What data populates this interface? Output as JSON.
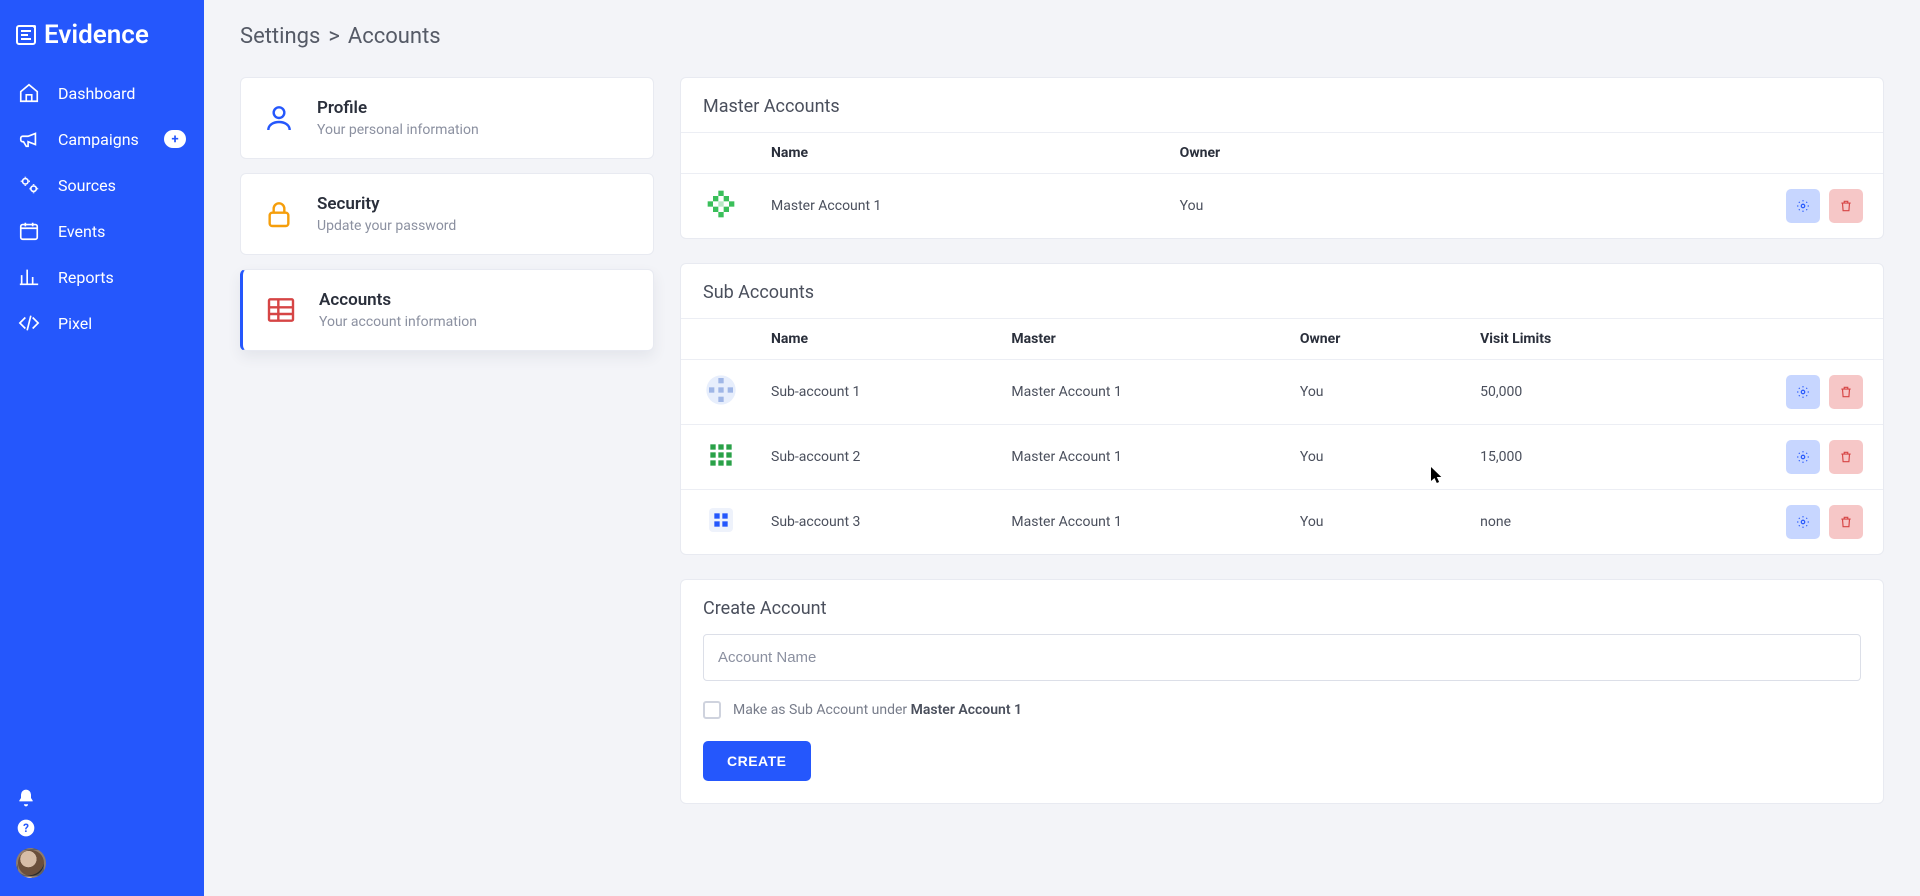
{
  "app_name": "Evidence",
  "sidebar": {
    "items": [
      {
        "label": "Dashboard"
      },
      {
        "label": "Campaigns",
        "has_plus": true
      },
      {
        "label": "Sources"
      },
      {
        "label": "Events"
      },
      {
        "label": "Reports"
      },
      {
        "label": "Pixel"
      }
    ]
  },
  "breadcrumb": {
    "parent": "Settings",
    "current": "Accounts"
  },
  "tabs": [
    {
      "title": "Profile",
      "subtitle": "Your personal information"
    },
    {
      "title": "Security",
      "subtitle": "Update your password"
    },
    {
      "title": "Accounts",
      "subtitle": "Your account information"
    }
  ],
  "master_accounts": {
    "heading": "Master Accounts",
    "columns": {
      "name": "Name",
      "owner": "Owner"
    },
    "rows": [
      {
        "name": "Master Account 1",
        "owner": "You"
      }
    ]
  },
  "sub_accounts": {
    "heading": "Sub Accounts",
    "columns": {
      "name": "Name",
      "master": "Master",
      "owner": "Owner",
      "visit_limits": "Visit Limits"
    },
    "rows": [
      {
        "name": "Sub-account 1",
        "master": "Master Account 1",
        "owner": "You",
        "visit_limits": "50,000"
      },
      {
        "name": "Sub-account 2",
        "master": "Master Account 1",
        "owner": "You",
        "visit_limits": "15,000"
      },
      {
        "name": "Sub-account 3",
        "master": "Master Account 1",
        "owner": "You",
        "visit_limits": "none"
      }
    ]
  },
  "create_account": {
    "heading": "Create Account",
    "placeholder": "Account Name",
    "checkbox_prefix": "Make as Sub Account under ",
    "checkbox_master": "Master Account 1",
    "button": "CREATE"
  }
}
